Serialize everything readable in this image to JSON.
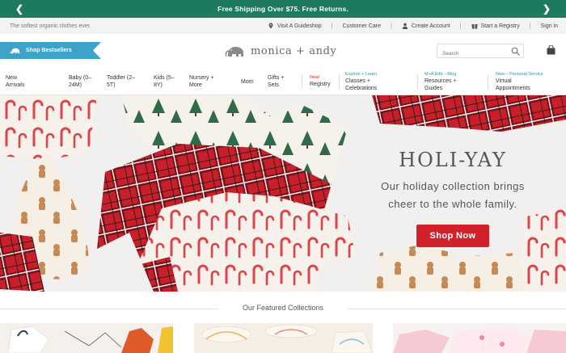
{
  "promo": {
    "text": "Free Shipping Over $75. Free Returns.",
    "prev_icon": "chevron-left-icon",
    "next_icon": "chevron-right-icon"
  },
  "utility": {
    "tagline": "The softest organic clothes ever.",
    "links": [
      {
        "label": "Visit A Guideshop",
        "icon": "location-pin-icon"
      },
      {
        "label": "Customer Care",
        "icon": ""
      },
      {
        "label": "Create Account",
        "icon": "user-icon"
      },
      {
        "label": "Start a Registry",
        "icon": "gift-icon"
      },
      {
        "label": "Sign in",
        "icon": ""
      }
    ]
  },
  "header": {
    "bestsellers_label": "Shop Bestsellers",
    "brand": "monica + andy",
    "search_placeholder": "Search",
    "bag_icon": "shopping-bag-icon"
  },
  "nav": {
    "items": [
      {
        "label1": "New",
        "label2": "Arrivals",
        "kicker": ""
      },
      {
        "label1": "Baby (0–",
        "label2": "24M)",
        "kicker": ""
      },
      {
        "label1": "Toddler (2–",
        "label2": "5T)",
        "kicker": ""
      },
      {
        "label1": "Kids (5–",
        "label2": "8Y)",
        "kicker": ""
      },
      {
        "label1": "Nursery +",
        "label2": "More",
        "kicker": ""
      },
      {
        "label1": "Mom",
        "label2": "",
        "kicker": ""
      },
      {
        "label1": "Gifts +",
        "label2": "Sets",
        "kicker": ""
      },
      {
        "label1": "Registry",
        "label2": "",
        "kicker": "New!"
      },
      {
        "label1": "Classes +",
        "label2": "Celebrations",
        "kicker": "Explore + Learn"
      },
      {
        "label1": "Resources +",
        "label2": "Guides",
        "kicker": "M+A Edit – Blog"
      },
      {
        "label1": "Virtual",
        "label2": "Appointments",
        "kicker": "New – Personal Service"
      }
    ]
  },
  "hero": {
    "title": "HOLI-YAY",
    "subtitle_line1": "Our holiday collection brings",
    "subtitle_line2": "cheer to the whole family.",
    "cta": "Shop Now"
  },
  "featured": {
    "title": "Our Featured Collections"
  },
  "colors": {
    "promo_green": "#1d7a5f",
    "bestseller_blue": "#3ea3c9",
    "cta_red": "#d1222b",
    "kicker_blue": "#2a8fb8"
  }
}
